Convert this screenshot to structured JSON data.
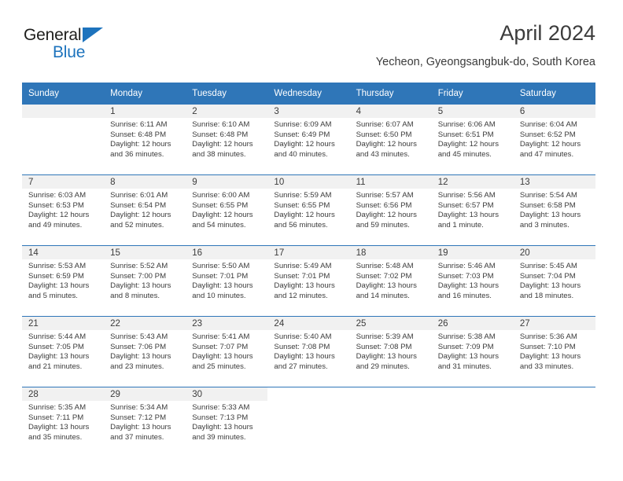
{
  "brand": {
    "name_part1": "General",
    "name_part2": "Blue",
    "triangle_icon": "brand-triangle-icon",
    "colors": {
      "general": "#1d1d1b",
      "blue": "#1d73bd"
    }
  },
  "header": {
    "title": "April 2024",
    "subtitle": "Yecheon, Gyeongsangbuk-do, South Korea"
  },
  "theme": {
    "header_blue": "#2f76b8",
    "daynum_strip": "#f1f1f1",
    "text": "#3b3b3b"
  },
  "calendar": {
    "weekday_headers": [
      "Sunday",
      "Monday",
      "Tuesday",
      "Wednesday",
      "Thursday",
      "Friday",
      "Saturday"
    ],
    "weeks": [
      [
        {
          "day": "",
          "sunrise": "",
          "sunset": "",
          "daylight_line1": "",
          "daylight_line2": ""
        },
        {
          "day": "1",
          "sunrise": "Sunrise: 6:11 AM",
          "sunset": "Sunset: 6:48 PM",
          "daylight_line1": "Daylight: 12 hours",
          "daylight_line2": "and 36 minutes."
        },
        {
          "day": "2",
          "sunrise": "Sunrise: 6:10 AM",
          "sunset": "Sunset: 6:48 PM",
          "daylight_line1": "Daylight: 12 hours",
          "daylight_line2": "and 38 minutes."
        },
        {
          "day": "3",
          "sunrise": "Sunrise: 6:09 AM",
          "sunset": "Sunset: 6:49 PM",
          "daylight_line1": "Daylight: 12 hours",
          "daylight_line2": "and 40 minutes."
        },
        {
          "day": "4",
          "sunrise": "Sunrise: 6:07 AM",
          "sunset": "Sunset: 6:50 PM",
          "daylight_line1": "Daylight: 12 hours",
          "daylight_line2": "and 43 minutes."
        },
        {
          "day": "5",
          "sunrise": "Sunrise: 6:06 AM",
          "sunset": "Sunset: 6:51 PM",
          "daylight_line1": "Daylight: 12 hours",
          "daylight_line2": "and 45 minutes."
        },
        {
          "day": "6",
          "sunrise": "Sunrise: 6:04 AM",
          "sunset": "Sunset: 6:52 PM",
          "daylight_line1": "Daylight: 12 hours",
          "daylight_line2": "and 47 minutes."
        }
      ],
      [
        {
          "day": "7",
          "sunrise": "Sunrise: 6:03 AM",
          "sunset": "Sunset: 6:53 PM",
          "daylight_line1": "Daylight: 12 hours",
          "daylight_line2": "and 49 minutes."
        },
        {
          "day": "8",
          "sunrise": "Sunrise: 6:01 AM",
          "sunset": "Sunset: 6:54 PM",
          "daylight_line1": "Daylight: 12 hours",
          "daylight_line2": "and 52 minutes."
        },
        {
          "day": "9",
          "sunrise": "Sunrise: 6:00 AM",
          "sunset": "Sunset: 6:55 PM",
          "daylight_line1": "Daylight: 12 hours",
          "daylight_line2": "and 54 minutes."
        },
        {
          "day": "10",
          "sunrise": "Sunrise: 5:59 AM",
          "sunset": "Sunset: 6:55 PM",
          "daylight_line1": "Daylight: 12 hours",
          "daylight_line2": "and 56 minutes."
        },
        {
          "day": "11",
          "sunrise": "Sunrise: 5:57 AM",
          "sunset": "Sunset: 6:56 PM",
          "daylight_line1": "Daylight: 12 hours",
          "daylight_line2": "and 59 minutes."
        },
        {
          "day": "12",
          "sunrise": "Sunrise: 5:56 AM",
          "sunset": "Sunset: 6:57 PM",
          "daylight_line1": "Daylight: 13 hours",
          "daylight_line2": "and 1 minute."
        },
        {
          "day": "13",
          "sunrise": "Sunrise: 5:54 AM",
          "sunset": "Sunset: 6:58 PM",
          "daylight_line1": "Daylight: 13 hours",
          "daylight_line2": "and 3 minutes."
        }
      ],
      [
        {
          "day": "14",
          "sunrise": "Sunrise: 5:53 AM",
          "sunset": "Sunset: 6:59 PM",
          "daylight_line1": "Daylight: 13 hours",
          "daylight_line2": "and 5 minutes."
        },
        {
          "day": "15",
          "sunrise": "Sunrise: 5:52 AM",
          "sunset": "Sunset: 7:00 PM",
          "daylight_line1": "Daylight: 13 hours",
          "daylight_line2": "and 8 minutes."
        },
        {
          "day": "16",
          "sunrise": "Sunrise: 5:50 AM",
          "sunset": "Sunset: 7:01 PM",
          "daylight_line1": "Daylight: 13 hours",
          "daylight_line2": "and 10 minutes."
        },
        {
          "day": "17",
          "sunrise": "Sunrise: 5:49 AM",
          "sunset": "Sunset: 7:01 PM",
          "daylight_line1": "Daylight: 13 hours",
          "daylight_line2": "and 12 minutes."
        },
        {
          "day": "18",
          "sunrise": "Sunrise: 5:48 AM",
          "sunset": "Sunset: 7:02 PM",
          "daylight_line1": "Daylight: 13 hours",
          "daylight_line2": "and 14 minutes."
        },
        {
          "day": "19",
          "sunrise": "Sunrise: 5:46 AM",
          "sunset": "Sunset: 7:03 PM",
          "daylight_line1": "Daylight: 13 hours",
          "daylight_line2": "and 16 minutes."
        },
        {
          "day": "20",
          "sunrise": "Sunrise: 5:45 AM",
          "sunset": "Sunset: 7:04 PM",
          "daylight_line1": "Daylight: 13 hours",
          "daylight_line2": "and 18 minutes."
        }
      ],
      [
        {
          "day": "21",
          "sunrise": "Sunrise: 5:44 AM",
          "sunset": "Sunset: 7:05 PM",
          "daylight_line1": "Daylight: 13 hours",
          "daylight_line2": "and 21 minutes."
        },
        {
          "day": "22",
          "sunrise": "Sunrise: 5:43 AM",
          "sunset": "Sunset: 7:06 PM",
          "daylight_line1": "Daylight: 13 hours",
          "daylight_line2": "and 23 minutes."
        },
        {
          "day": "23",
          "sunrise": "Sunrise: 5:41 AM",
          "sunset": "Sunset: 7:07 PM",
          "daylight_line1": "Daylight: 13 hours",
          "daylight_line2": "and 25 minutes."
        },
        {
          "day": "24",
          "sunrise": "Sunrise: 5:40 AM",
          "sunset": "Sunset: 7:08 PM",
          "daylight_line1": "Daylight: 13 hours",
          "daylight_line2": "and 27 minutes."
        },
        {
          "day": "25",
          "sunrise": "Sunrise: 5:39 AM",
          "sunset": "Sunset: 7:08 PM",
          "daylight_line1": "Daylight: 13 hours",
          "daylight_line2": "and 29 minutes."
        },
        {
          "day": "26",
          "sunrise": "Sunrise: 5:38 AM",
          "sunset": "Sunset: 7:09 PM",
          "daylight_line1": "Daylight: 13 hours",
          "daylight_line2": "and 31 minutes."
        },
        {
          "day": "27",
          "sunrise": "Sunrise: 5:36 AM",
          "sunset": "Sunset: 7:10 PM",
          "daylight_line1": "Daylight: 13 hours",
          "daylight_line2": "and 33 minutes."
        }
      ],
      [
        {
          "day": "28",
          "sunrise": "Sunrise: 5:35 AM",
          "sunset": "Sunset: 7:11 PM",
          "daylight_line1": "Daylight: 13 hours",
          "daylight_line2": "and 35 minutes."
        },
        {
          "day": "29",
          "sunrise": "Sunrise: 5:34 AM",
          "sunset": "Sunset: 7:12 PM",
          "daylight_line1": "Daylight: 13 hours",
          "daylight_line2": "and 37 minutes."
        },
        {
          "day": "30",
          "sunrise": "Sunrise: 5:33 AM",
          "sunset": "Sunset: 7:13 PM",
          "daylight_line1": "Daylight: 13 hours",
          "daylight_line2": "and 39 minutes."
        },
        {
          "day": "",
          "sunrise": "",
          "sunset": "",
          "daylight_line1": "",
          "daylight_line2": ""
        },
        {
          "day": "",
          "sunrise": "",
          "sunset": "",
          "daylight_line1": "",
          "daylight_line2": ""
        },
        {
          "day": "",
          "sunrise": "",
          "sunset": "",
          "daylight_line1": "",
          "daylight_line2": ""
        },
        {
          "day": "",
          "sunrise": "",
          "sunset": "",
          "daylight_line1": "",
          "daylight_line2": ""
        }
      ]
    ]
  }
}
